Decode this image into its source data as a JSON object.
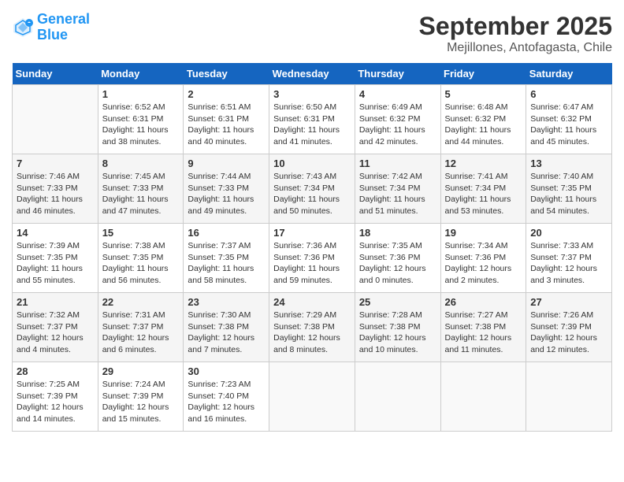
{
  "header": {
    "logo_line1": "General",
    "logo_line2": "Blue",
    "month_title": "September 2025",
    "location": "Mejillones, Antofagasta, Chile"
  },
  "days_of_week": [
    "Sunday",
    "Monday",
    "Tuesday",
    "Wednesday",
    "Thursday",
    "Friday",
    "Saturday"
  ],
  "weeks": [
    [
      {
        "day": "",
        "sunrise": "",
        "sunset": "",
        "daylight": ""
      },
      {
        "day": "1",
        "sunrise": "Sunrise: 6:52 AM",
        "sunset": "Sunset: 6:31 PM",
        "daylight": "Daylight: 11 hours and 38 minutes."
      },
      {
        "day": "2",
        "sunrise": "Sunrise: 6:51 AM",
        "sunset": "Sunset: 6:31 PM",
        "daylight": "Daylight: 11 hours and 40 minutes."
      },
      {
        "day": "3",
        "sunrise": "Sunrise: 6:50 AM",
        "sunset": "Sunset: 6:31 PM",
        "daylight": "Daylight: 11 hours and 41 minutes."
      },
      {
        "day": "4",
        "sunrise": "Sunrise: 6:49 AM",
        "sunset": "Sunset: 6:32 PM",
        "daylight": "Daylight: 11 hours and 42 minutes."
      },
      {
        "day": "5",
        "sunrise": "Sunrise: 6:48 AM",
        "sunset": "Sunset: 6:32 PM",
        "daylight": "Daylight: 11 hours and 44 minutes."
      },
      {
        "day": "6",
        "sunrise": "Sunrise: 6:47 AM",
        "sunset": "Sunset: 6:32 PM",
        "daylight": "Daylight: 11 hours and 45 minutes."
      }
    ],
    [
      {
        "day": "7",
        "sunrise": "Sunrise: 7:46 AM",
        "sunset": "Sunset: 7:33 PM",
        "daylight": "Daylight: 11 hours and 46 minutes."
      },
      {
        "day": "8",
        "sunrise": "Sunrise: 7:45 AM",
        "sunset": "Sunset: 7:33 PM",
        "daylight": "Daylight: 11 hours and 47 minutes."
      },
      {
        "day": "9",
        "sunrise": "Sunrise: 7:44 AM",
        "sunset": "Sunset: 7:33 PM",
        "daylight": "Daylight: 11 hours and 49 minutes."
      },
      {
        "day": "10",
        "sunrise": "Sunrise: 7:43 AM",
        "sunset": "Sunset: 7:34 PM",
        "daylight": "Daylight: 11 hours and 50 minutes."
      },
      {
        "day": "11",
        "sunrise": "Sunrise: 7:42 AM",
        "sunset": "Sunset: 7:34 PM",
        "daylight": "Daylight: 11 hours and 51 minutes."
      },
      {
        "day": "12",
        "sunrise": "Sunrise: 7:41 AM",
        "sunset": "Sunset: 7:34 PM",
        "daylight": "Daylight: 11 hours and 53 minutes."
      },
      {
        "day": "13",
        "sunrise": "Sunrise: 7:40 AM",
        "sunset": "Sunset: 7:35 PM",
        "daylight": "Daylight: 11 hours and 54 minutes."
      }
    ],
    [
      {
        "day": "14",
        "sunrise": "Sunrise: 7:39 AM",
        "sunset": "Sunset: 7:35 PM",
        "daylight": "Daylight: 11 hours and 55 minutes."
      },
      {
        "day": "15",
        "sunrise": "Sunrise: 7:38 AM",
        "sunset": "Sunset: 7:35 PM",
        "daylight": "Daylight: 11 hours and 56 minutes."
      },
      {
        "day": "16",
        "sunrise": "Sunrise: 7:37 AM",
        "sunset": "Sunset: 7:35 PM",
        "daylight": "Daylight: 11 hours and 58 minutes."
      },
      {
        "day": "17",
        "sunrise": "Sunrise: 7:36 AM",
        "sunset": "Sunset: 7:36 PM",
        "daylight": "Daylight: 11 hours and 59 minutes."
      },
      {
        "day": "18",
        "sunrise": "Sunrise: 7:35 AM",
        "sunset": "Sunset: 7:36 PM",
        "daylight": "Daylight: 12 hours and 0 minutes."
      },
      {
        "day": "19",
        "sunrise": "Sunrise: 7:34 AM",
        "sunset": "Sunset: 7:36 PM",
        "daylight": "Daylight: 12 hours and 2 minutes."
      },
      {
        "day": "20",
        "sunrise": "Sunrise: 7:33 AM",
        "sunset": "Sunset: 7:37 PM",
        "daylight": "Daylight: 12 hours and 3 minutes."
      }
    ],
    [
      {
        "day": "21",
        "sunrise": "Sunrise: 7:32 AM",
        "sunset": "Sunset: 7:37 PM",
        "daylight": "Daylight: 12 hours and 4 minutes."
      },
      {
        "day": "22",
        "sunrise": "Sunrise: 7:31 AM",
        "sunset": "Sunset: 7:37 PM",
        "daylight": "Daylight: 12 hours and 6 minutes."
      },
      {
        "day": "23",
        "sunrise": "Sunrise: 7:30 AM",
        "sunset": "Sunset: 7:38 PM",
        "daylight": "Daylight: 12 hours and 7 minutes."
      },
      {
        "day": "24",
        "sunrise": "Sunrise: 7:29 AM",
        "sunset": "Sunset: 7:38 PM",
        "daylight": "Daylight: 12 hours and 8 minutes."
      },
      {
        "day": "25",
        "sunrise": "Sunrise: 7:28 AM",
        "sunset": "Sunset: 7:38 PM",
        "daylight": "Daylight: 12 hours and 10 minutes."
      },
      {
        "day": "26",
        "sunrise": "Sunrise: 7:27 AM",
        "sunset": "Sunset: 7:38 PM",
        "daylight": "Daylight: 12 hours and 11 minutes."
      },
      {
        "day": "27",
        "sunrise": "Sunrise: 7:26 AM",
        "sunset": "Sunset: 7:39 PM",
        "daylight": "Daylight: 12 hours and 12 minutes."
      }
    ],
    [
      {
        "day": "28",
        "sunrise": "Sunrise: 7:25 AM",
        "sunset": "Sunset: 7:39 PM",
        "daylight": "Daylight: 12 hours and 14 minutes."
      },
      {
        "day": "29",
        "sunrise": "Sunrise: 7:24 AM",
        "sunset": "Sunset: 7:39 PM",
        "daylight": "Daylight: 12 hours and 15 minutes."
      },
      {
        "day": "30",
        "sunrise": "Sunrise: 7:23 AM",
        "sunset": "Sunset: 7:40 PM",
        "daylight": "Daylight: 12 hours and 16 minutes."
      },
      {
        "day": "",
        "sunrise": "",
        "sunset": "",
        "daylight": ""
      },
      {
        "day": "",
        "sunrise": "",
        "sunset": "",
        "daylight": ""
      },
      {
        "day": "",
        "sunrise": "",
        "sunset": "",
        "daylight": ""
      },
      {
        "day": "",
        "sunrise": "",
        "sunset": "",
        "daylight": ""
      }
    ]
  ]
}
